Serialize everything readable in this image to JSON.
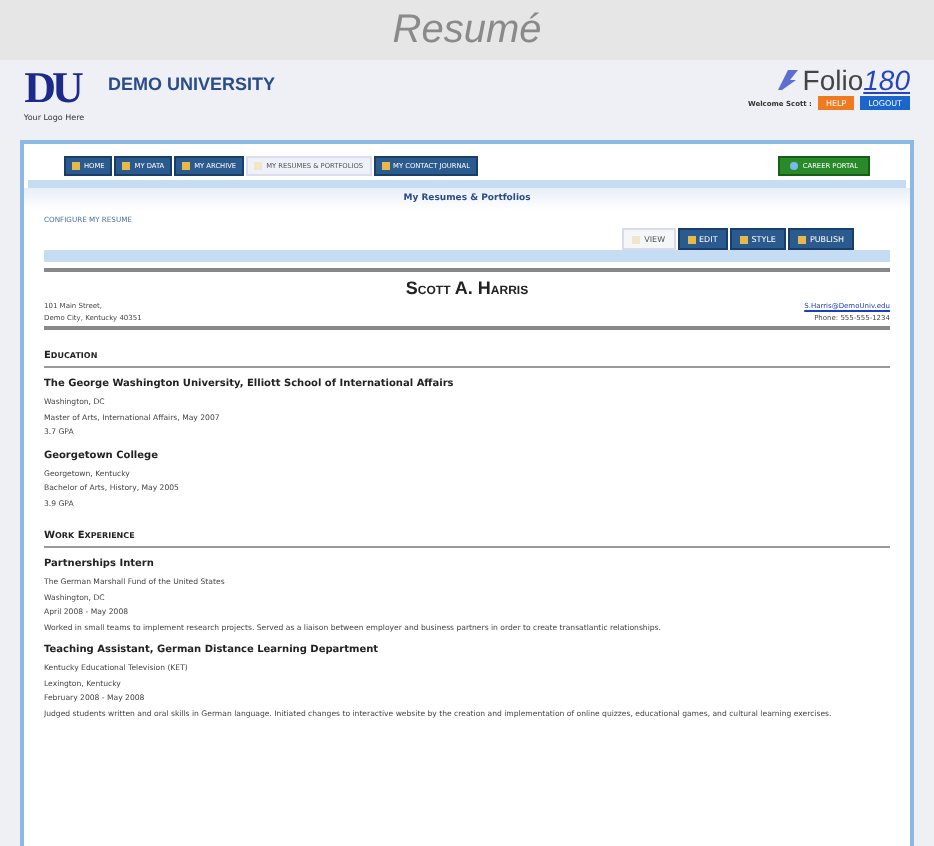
{
  "page_title": "Resumé",
  "header": {
    "logo_letters": "DU",
    "logo_caption": "Your Logo Here",
    "university": "DEMO UNIVERSITY",
    "brand_word": "Folio",
    "brand_number": "180",
    "welcome": "Welcome Scott :",
    "help": "HELP",
    "logout": "LOGOUT"
  },
  "nav": [
    {
      "label": "HOME",
      "selected": false
    },
    {
      "label": "MY DATA",
      "selected": false
    },
    {
      "label": "MY ARCHIVE",
      "selected": false
    },
    {
      "label": "MY RESUMES & PORTFOLIOS",
      "selected": true
    },
    {
      "label": "MY CONTACT JOURNAL",
      "selected": false
    }
  ],
  "career_portal": "CAREER PORTAL",
  "section_title": "My Resumes & Portfolios",
  "configure_link": "CONFIGURE MY RESUME",
  "resume_tabs": [
    {
      "label": "VIEW",
      "selected": true
    },
    {
      "label": "EDIT",
      "selected": false
    },
    {
      "label": "STYLE",
      "selected": false
    },
    {
      "label": "PUBLISH",
      "selected": false
    }
  ],
  "resume": {
    "name": "Scott A. Harris",
    "address": [
      "101 Main Street,",
      "Demo City, Kentucky 40351"
    ],
    "email": "S.Harris@DemoUniv.edu",
    "phone": "Phone: 555-555-1234",
    "sections": [
      {
        "heading": "Education",
        "entries": [
          {
            "title": "The George Washington University, Elliott School of International Affairs",
            "lines": [
              "Washington, DC",
              "Master of Arts, International Affairs, May 2007",
              "3.7 GPA"
            ]
          },
          {
            "title": "Georgetown College",
            "lines": [
              "Georgetown, Kentucky",
              "Bachelor of Arts, History, May 2005",
              "3.9 GPA"
            ]
          }
        ]
      },
      {
        "heading": "Work Experience",
        "entries": [
          {
            "title": "Partnerships Intern",
            "lines": [
              "The German Marshall Fund of the United States",
              "Washington, DC",
              "April 2008 - May 2008",
              "Worked in small teams to implement research projects. Served as a liaison between employer and business partners in order to create transatlantic relationships."
            ]
          },
          {
            "title": "Teaching Assistant, German Distance Learning Department",
            "lines": [
              "Kentucky Educational Television (KET)",
              "Lexington, Kentucky",
              "February 2008 - May 2008",
              "Judged students written and oral skills in German language. Initiated changes to interactive website by the creation and implementation of online quizzes, educational games, and cultural learning exercises."
            ]
          }
        ]
      }
    ]
  }
}
